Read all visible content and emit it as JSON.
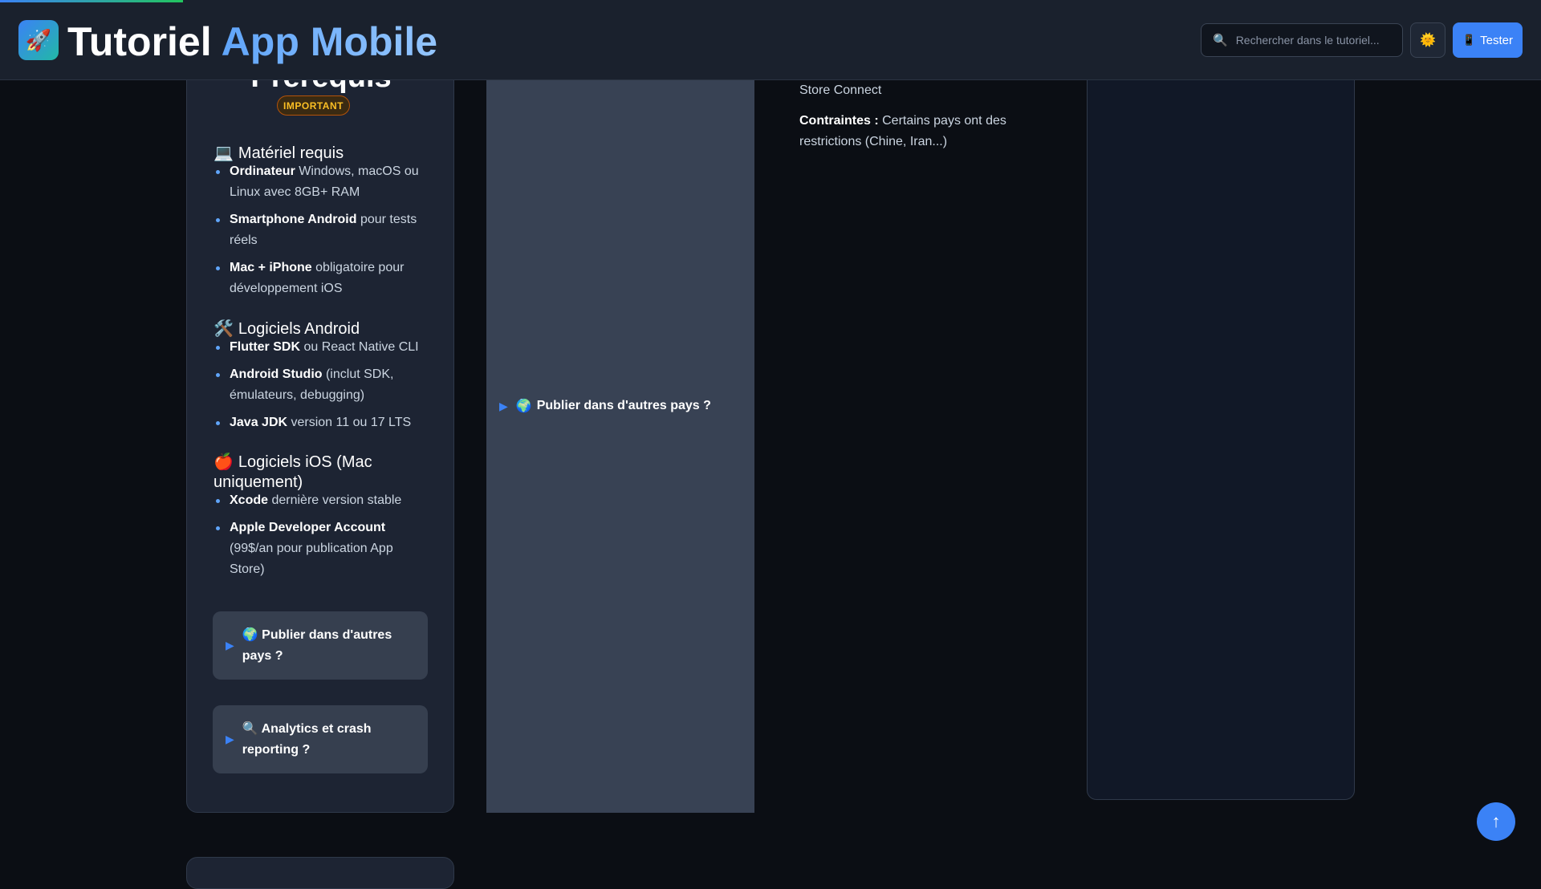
{
  "header": {
    "logo_icon": "🚀",
    "title_part1": "Tutoriel",
    "title_part2": "App Mobile",
    "search_icon": "🔍",
    "search_placeholder": "Rechercher dans le tutoriel...",
    "theme_icon": "🌞",
    "test_icon": "📱",
    "test_label": "Tester"
  },
  "left_card": {
    "title": "Prérequis",
    "badge": "IMPORTANT",
    "sections": [
      {
        "emoji": "💻",
        "title": "Matériel requis",
        "items": [
          {
            "bold": "Ordinateur",
            "text": " Windows, macOS ou Linux avec 8GB+ RAM"
          },
          {
            "bold": "Smartphone Android",
            "text": " pour tests réels"
          },
          {
            "bold": "Mac + iPhone",
            "text": " obligatoire pour développement iOS"
          }
        ]
      },
      {
        "emoji": "🛠️",
        "title": "Logiciels Android",
        "items": [
          {
            "bold": "Flutter SDK",
            "text": " ou React Native CLI"
          },
          {
            "bold": "Android Studio",
            "text": " (inclut SDK, émulateurs, debugging)"
          },
          {
            "bold": "Java JDK",
            "text": " version 11 ou 17 LTS"
          }
        ]
      },
      {
        "emoji": "🍎",
        "title": "Logiciels iOS (Mac uniquement)",
        "items": [
          {
            "bold": "Xcode",
            "text": " dernière version stable"
          },
          {
            "bold": "Apple Developer Account",
            "text": " (99$/an pour publication App Store)"
          }
        ]
      }
    ],
    "faqs": [
      {
        "arrow": "▶",
        "emoji": "🌍",
        "label": "Publier dans d'autres pays ?"
      },
      {
        "arrow": "▶",
        "emoji": "🔍",
        "label": "Analytics et crash reporting ?"
      }
    ]
  },
  "middle_panel": {
    "faq": {
      "arrow": "▶",
      "emoji": "🌍",
      "label": "Publier dans d'autres pays ?"
    }
  },
  "text_column": {
    "p1": "Store Connect",
    "p2_bold": "Contraintes :",
    "p2_text": " Certains pays ont des restrictions (Chine, Iran...)"
  },
  "scroll_top": {
    "icon": "↑"
  }
}
